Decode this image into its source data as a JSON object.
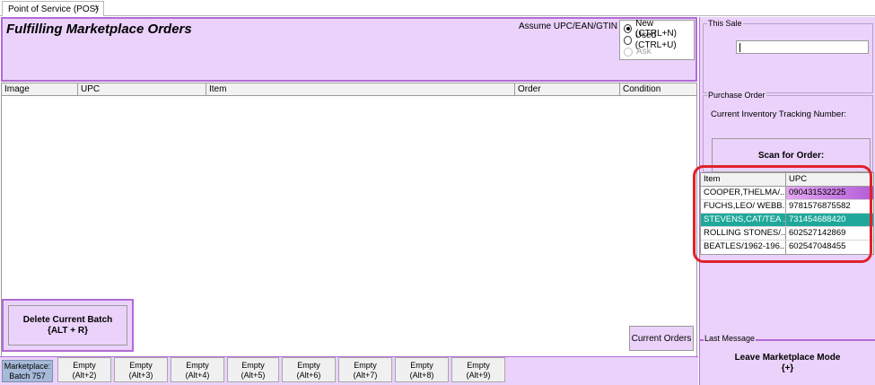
{
  "tab": {
    "title": "Point of Service (POS)",
    "close": "×"
  },
  "header": {
    "title": "Fulfilling Marketplace Orders",
    "assume_label": "Assume UPC/EAN/GTIN are:",
    "options": [
      {
        "label": "New (CTRL+N)",
        "checked": true,
        "disabled": false
      },
      {
        "label": "Used (CTRL+U)",
        "checked": false,
        "disabled": false
      },
      {
        "label": "Ask",
        "checked": false,
        "disabled": true
      }
    ]
  },
  "grid": {
    "columns": [
      "Image",
      "UPC",
      "Item",
      "Order",
      "Condition"
    ]
  },
  "actions": {
    "delete_line1": "Delete Current Batch",
    "delete_line2": "{ALT + R}",
    "current_orders": "Current Orders"
  },
  "bottom_bar": {
    "marketplace_line1": "Marketplace:",
    "marketplace_line2": "Batch 757",
    "slots": [
      {
        "label": "Empty",
        "shortcut": "(Alt+2)"
      },
      {
        "label": "Empty",
        "shortcut": "(Alt+3)"
      },
      {
        "label": "Empty",
        "shortcut": "(Alt+4)"
      },
      {
        "label": "Empty",
        "shortcut": "(Alt+5)"
      },
      {
        "label": "Empty",
        "shortcut": "(Alt+6)"
      },
      {
        "label": "Empty",
        "shortcut": "(Alt+7)"
      },
      {
        "label": "Empty",
        "shortcut": "(Alt+8)"
      },
      {
        "label": "Empty",
        "shortcut": "(Alt+9)"
      }
    ]
  },
  "right": {
    "this_sale_legend": "This Sale",
    "sale_input_value": "",
    "purchase_order_legend": "Purchase Order",
    "tracking_label": "Current Inventory Tracking Number:",
    "scan_label": "Scan for Order:",
    "orders_columns": [
      "Item",
      "UPC"
    ],
    "orders": [
      {
        "item": "COOPER,THELMA/...",
        "upc": "090431532225"
      },
      {
        "item": "FUCHS,LEO/ WEBB...",
        "upc": "9781576875582"
      },
      {
        "item": "STEVENS,CAT/TEA ...",
        "upc": "731454688420"
      },
      {
        "item": "ROLLING STONES/...",
        "upc": "602527142869"
      },
      {
        "item": "BEATLES/1962-196...",
        "upc": "602547048455"
      }
    ],
    "last_message_legend": "Last Message",
    "leave_line1": "Leave Marketplace Mode",
    "leave_line2": "{+}"
  },
  "colors": {
    "panel_bg": "#ebd2fa",
    "panel_border": "#b06bd6",
    "teal_row": "#1fa89a",
    "highlight_ring": "#e0212a",
    "marketplace_btn": "#a6b9d8"
  }
}
